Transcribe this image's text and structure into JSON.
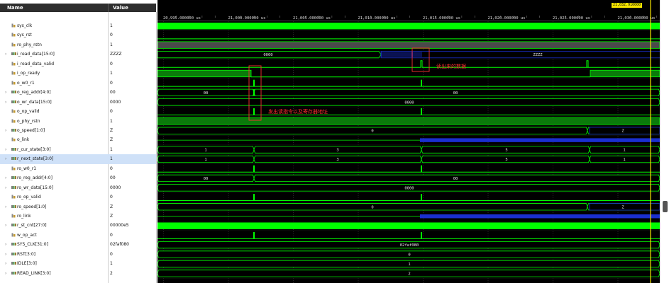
{
  "columns": {
    "name": "Name",
    "value": "Value"
  },
  "cursor_time": "21,032.910000",
  "timeline": {
    "ticks": [
      "20,995.000000 us",
      "21,000.000000 us",
      "21,005.000000 us",
      "21,010.000000 us",
      "21,015.000000 us",
      "21,020.000000 us",
      "21,025.000000 us",
      "21,030.000000 us"
    ]
  },
  "signals": [
    {
      "name": "sys_clk",
      "value": "1",
      "kind": "bit",
      "expandable": false
    },
    {
      "name": "sys_rst",
      "value": "0",
      "kind": "bit",
      "expandable": false
    },
    {
      "name": "ro_phy_rstn",
      "value": "1",
      "kind": "bit",
      "expandable": false
    },
    {
      "name": "i_read_data[15:0]",
      "value": "ZZZZ",
      "kind": "bus",
      "expandable": true
    },
    {
      "name": "i_read_data_valid",
      "value": "0",
      "kind": "bit",
      "expandable": false
    },
    {
      "name": "i_op_ready",
      "value": "1",
      "kind": "bit",
      "expandable": false
    },
    {
      "name": "o_w0_r1",
      "value": "0",
      "kind": "bit",
      "expandable": false
    },
    {
      "name": "o_reg_addr[4:0]",
      "value": "00",
      "kind": "bus",
      "expandable": true
    },
    {
      "name": "o_wr_data[15:0]",
      "value": "0000",
      "kind": "bus",
      "expandable": true
    },
    {
      "name": "o_op_valid",
      "value": "0",
      "kind": "bit",
      "expandable": false
    },
    {
      "name": "o_phy_rstn",
      "value": "1",
      "kind": "bit",
      "expandable": false
    },
    {
      "name": "o_speed[1:0]",
      "value": "Z",
      "kind": "bus",
      "expandable": true
    },
    {
      "name": "o_link",
      "value": "Z",
      "kind": "bit",
      "expandable": false
    },
    {
      "name": "r_cur_state[3:0]",
      "value": "1",
      "kind": "bus",
      "expandable": true
    },
    {
      "name": "r_next_state[3:0]",
      "value": "1",
      "kind": "bus",
      "expandable": true,
      "selected": true
    },
    {
      "name": "ro_w0_r1",
      "value": "0",
      "kind": "bit",
      "expandable": false
    },
    {
      "name": "ro_reg_addr[4:0]",
      "value": "00",
      "kind": "bus",
      "expandable": true
    },
    {
      "name": "ro_wr_data[15:0]",
      "value": "0000",
      "kind": "bus",
      "expandable": true
    },
    {
      "name": "ro_op_valid",
      "value": "0",
      "kind": "bit",
      "expandable": false
    },
    {
      "name": "ro_speed[1:0]",
      "value": "Z",
      "kind": "bus",
      "expandable": true
    },
    {
      "name": "ro_link",
      "value": "Z",
      "kind": "bit",
      "expandable": false
    },
    {
      "name": "r_st_cnt[27:0]",
      "value": "00000e5",
      "kind": "bus",
      "expandable": true
    },
    {
      "name": "w_op_act",
      "value": "0",
      "kind": "bit",
      "expandable": false
    },
    {
      "name": "SYS_CLK[31:0]",
      "value": "02faf080",
      "kind": "bus",
      "expandable": true
    },
    {
      "name": "RST[3:0]",
      "value": "0",
      "kind": "bus",
      "expandable": true
    },
    {
      "name": "IDLE[3:0]",
      "value": "1",
      "kind": "bus",
      "expandable": true
    },
    {
      "name": "READ_LINK[3:0]",
      "value": "2",
      "kind": "bus",
      "expandable": true
    }
  ],
  "wave_labels": {
    "i_read_data_a": "0000",
    "i_read_data_b": "ZZZZ",
    "o_reg_addr_a": "00",
    "o_reg_addr_b": "00",
    "o_wr_data": "0000",
    "o_speed_a": "0",
    "o_speed_b": "Z",
    "state_1a": "1",
    "state_3": "3",
    "state_5": "5",
    "state_1b": "1",
    "ro_reg_addr_a": "00",
    "ro_reg_addr_b": "00",
    "ro_wr_data": "0000",
    "ro_speed_a": "0",
    "ro_speed_b": "Z",
    "sys_clk_val": "02faf080",
    "rst_val": "0",
    "idle_val": "1",
    "read_link_val": "2"
  },
  "annotations": {
    "read_data_note": "读出来的数据",
    "read_cmd_note": "发出读指令以及寄存器地址"
  },
  "colors": {
    "wave_green": "#00ff00",
    "wave_dark_green": "#0b7a0b",
    "highz_blue": "#1a2fd0",
    "cursor_yellow": "#f5e400",
    "annotation_red": "#ff3030"
  }
}
